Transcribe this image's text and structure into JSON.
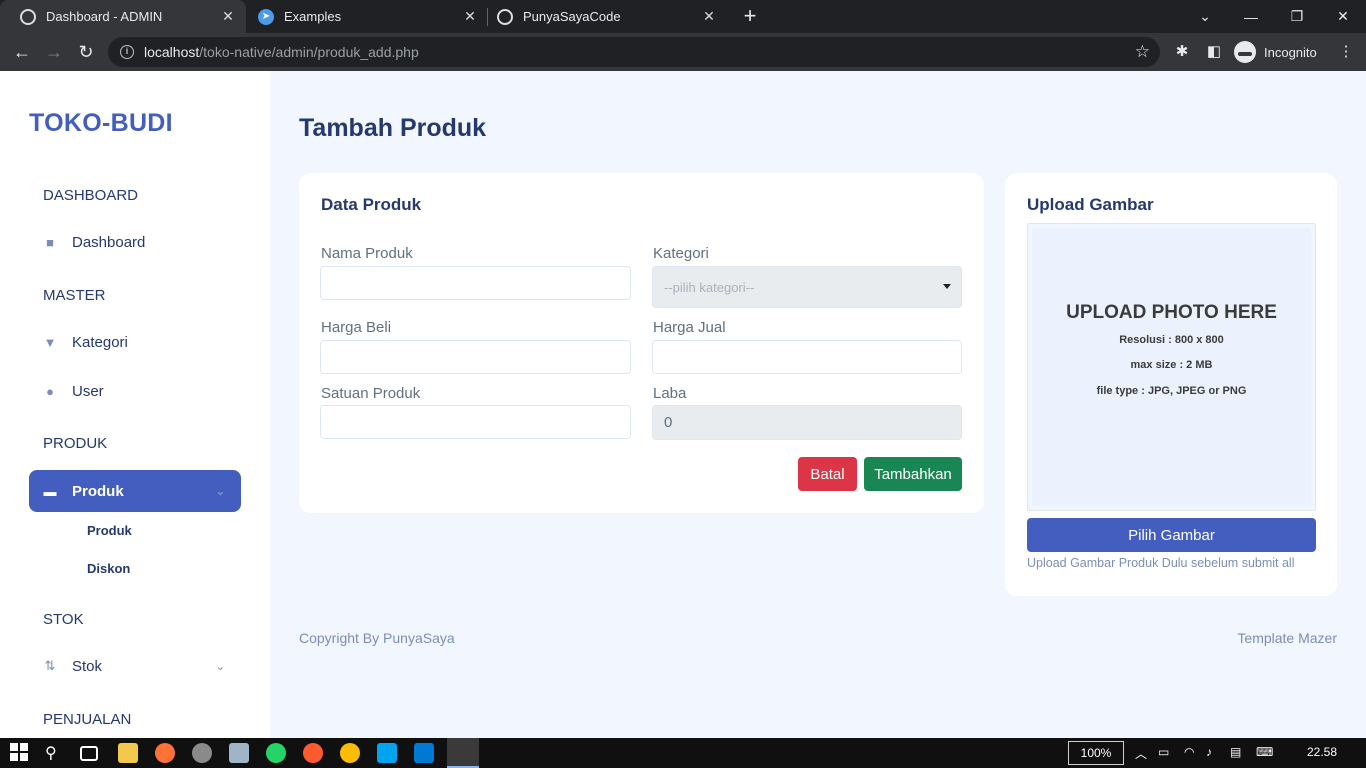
{
  "browser": {
    "tabs": [
      {
        "title": "Dashboard - ADMIN",
        "active": true
      },
      {
        "title": "Examples",
        "active": false
      },
      {
        "title": "PunyaSayaCode",
        "active": false
      }
    ],
    "url_host": "localhost",
    "url_path": "/toko-native/admin/produk_add.php",
    "profile_label": "Incognito"
  },
  "sidebar": {
    "brand": "TOKO-BUDI",
    "sections": {
      "dashboard": "DASHBOARD",
      "master": "MASTER",
      "produk": "PRODUK",
      "stok": "STOK",
      "penjualan": "PENJUALAN"
    },
    "items": {
      "dashboard": "Dashboard",
      "kategori": "Kategori",
      "user": "User",
      "produk": "Produk",
      "stok": "Stok"
    },
    "sub_items": {
      "produk": "Produk",
      "diskon": "Diskon"
    }
  },
  "main": {
    "page_title": "Tambah Produk",
    "form": {
      "card_title": "Data Produk",
      "nama_label": "Nama Produk",
      "kategori_label": "Kategori",
      "kategori_placeholder": "--pilih kategori--",
      "beli_label": "Harga Beli",
      "jual_label": "Harga Jual",
      "satuan_label": "Satuan Produk",
      "laba_label": "Laba",
      "laba_value": "0",
      "cancel_label": "Batal",
      "submit_label": "Tambahkan"
    },
    "upload": {
      "card_title": "Upload Gambar",
      "heading": "UPLOAD PHOTO HERE",
      "resolution": "Resolusi : 800 x 800",
      "max_size": "max size : 2 MB",
      "file_type": "file type : JPG, JPEG or PNG",
      "button_label": "Pilih Gambar",
      "hint": "Upload Gambar Produk Dulu sebelum submit all"
    },
    "footer_left": "Copyright By PunyaSaya",
    "footer_right": "Template Mazer"
  },
  "taskbar": {
    "zoom": "100%",
    "time": "22.58"
  },
  "colors": {
    "primary": "#435ebe",
    "danger": "#dc3545",
    "success": "#198754",
    "heading": "#25396f",
    "background": "#f2f7ff"
  }
}
